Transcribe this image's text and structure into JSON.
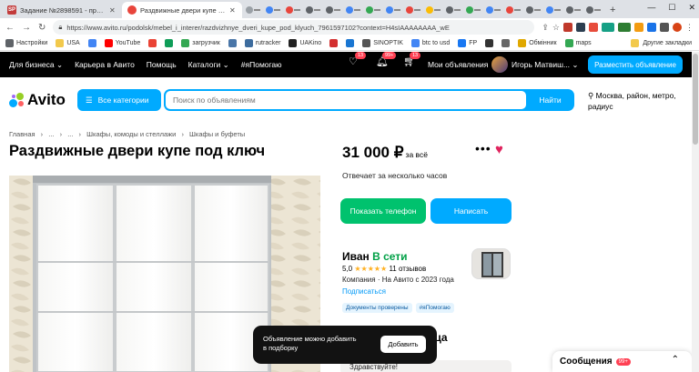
{
  "browser": {
    "tabs": [
      {
        "label": "Задание №2898591 - просмотр",
        "active": false,
        "favicon_text": "SP"
      },
      {
        "label": "Раздвижные двери купе под кл",
        "active": true,
        "favicon_text": ""
      }
    ],
    "url": "https://www.avito.ru/podolsk/mebel_i_interer/razdvizhnye_dveri_kupe_pod_klyuch_7961597102?context=H4sIAAAAAAAA_wE",
    "bookmarks": [
      "Настройки",
      "USA",
      "",
      "YouTube",
      "",
      "",
      "загрузчик",
      "",
      "rutracker",
      "UAKino",
      "",
      "",
      "SINOPTIK",
      "btc to usd",
      "FP",
      "",
      "",
      "Обмінник",
      "maps"
    ],
    "bookmarks_right": "Другие закладки",
    "colors": {
      "tabstrip": "#dee1e6"
    }
  },
  "topbar": {
    "links": [
      "Для бизнеса ⌄",
      "Карьера в Авито",
      "Помощь",
      "Каталоги ⌄",
      "#яПомогаю"
    ],
    "badges": [
      "13",
      "99+",
      "13"
    ],
    "my_ads": "Мои объявления",
    "user_name": "Игорь Матвиш... ⌄",
    "post_button": "Разместить объявление",
    "colors": {
      "bg": "#000000",
      "accent": "#00aaff"
    }
  },
  "search": {
    "logo": "Avito",
    "categories_button": "Все категории",
    "placeholder": "Поиск по объявлениям",
    "find_button": "Найти",
    "location": "Москва, район, метро, радиус"
  },
  "breadcrumb": [
    "Главная",
    "›",
    "...",
    "›",
    "...",
    "›",
    "Шкафы, комоды и стеллажи",
    "›",
    "Шкафы и буфеты"
  ],
  "listing": {
    "title": "Раздвижные двери купе под ключ",
    "price": "31 000 ₽",
    "price_suffix": "за всё",
    "response_time": "Отвечает за несколько часов",
    "show_phone_button": "Показать телефон",
    "write_button": "Написать"
  },
  "seller": {
    "name": "Иван",
    "status": "В сети",
    "rating": "5,0",
    "stars": "★★★★★",
    "reviews": "11 отзывов",
    "company_line": "Компания · На Авито с 2023 года",
    "subscribe": "Подписаться",
    "chips": [
      "Документы проверены",
      "#яПомогаю"
    ]
  },
  "chat": {
    "heading_partial": "вца",
    "greeting": "Здравствуйте!"
  },
  "toast": {
    "text_line1": "Объявление можно добавить",
    "text_line2": "в подборку",
    "button": "Добавить"
  },
  "messages": {
    "label": "Сообщения",
    "badge": "99+"
  }
}
